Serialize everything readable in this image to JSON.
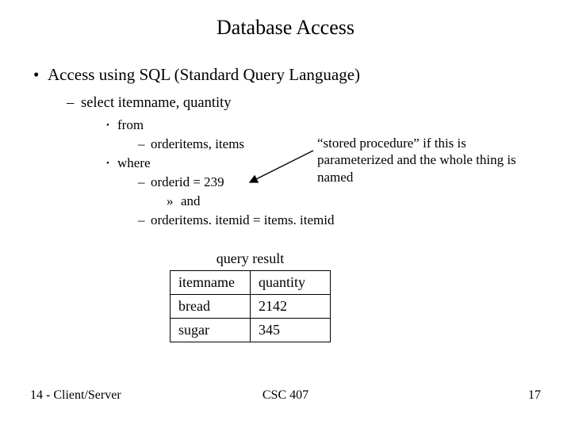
{
  "title": "Database Access",
  "bullet_main": "Access using SQL (Standard Query Language)",
  "bullet_sub": "select itemname, quantity",
  "sql": {
    "from": "from",
    "from_clause": "orderitems, items",
    "where": "where",
    "where_clause": "orderid = 239",
    "and": "and",
    "join": "orderitems. itemid = items. itemid"
  },
  "annotation": "“stored procedure” if this is parameterized and the whole thing is named",
  "table": {
    "caption": "query result",
    "headers": [
      "itemname",
      "quantity"
    ],
    "rows": [
      [
        "bread",
        "2142"
      ],
      [
        "sugar",
        "345"
      ]
    ]
  },
  "footer": {
    "left": "14 - Client/Server",
    "center": "CSC 407",
    "right": "17"
  }
}
